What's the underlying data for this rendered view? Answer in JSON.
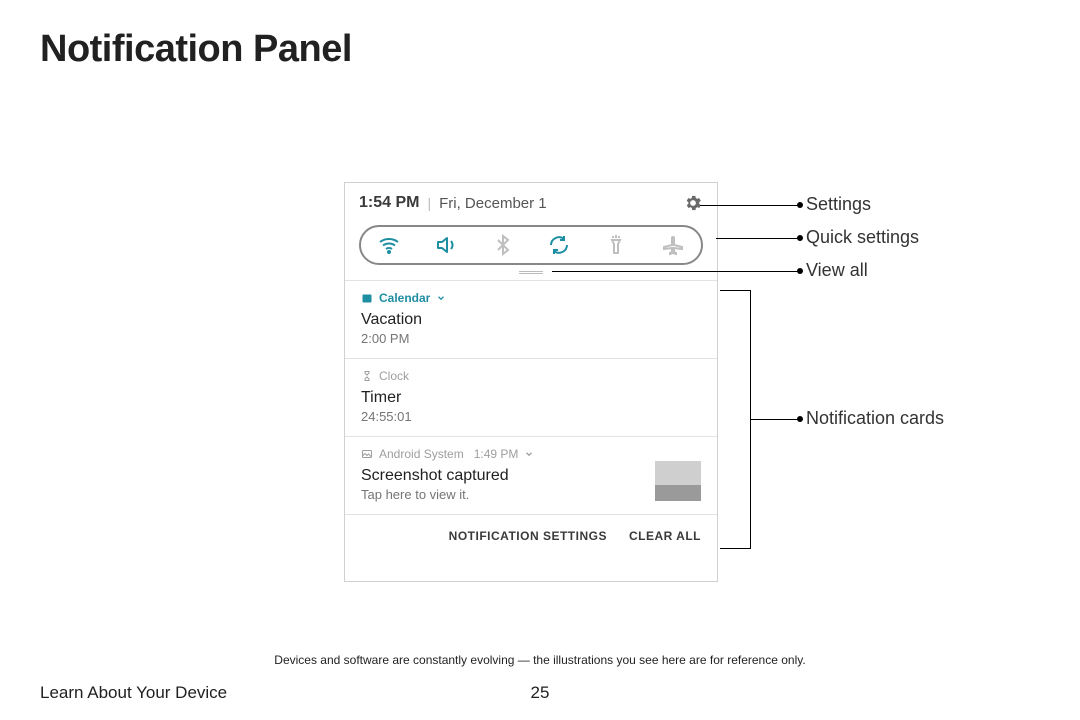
{
  "page": {
    "title": "Notification Panel",
    "disclaimer": "Devices and software are constantly evolving — the illustrations you see here are for reference only.",
    "section": "Learn About Your Device",
    "number": "25"
  },
  "callouts": {
    "settings": "Settings",
    "quick_settings": "Quick settings",
    "view_all": "View all",
    "notification_cards": "Notification cards"
  },
  "panel": {
    "time": "1:54 PM",
    "date": "Fri, December 1",
    "divider": "|",
    "footer": {
      "settings": "NOTIFICATION SETTINGS",
      "clear": "CLEAR ALL"
    }
  },
  "cards": [
    {
      "app": "Calendar",
      "title": "Vacation",
      "sub": "2:00 PM",
      "time": ""
    },
    {
      "app": "Clock",
      "title": "Timer",
      "sub": "24:55:01",
      "time": ""
    },
    {
      "app": "Android System",
      "title": "Screenshot captured",
      "sub": "Tap here to view it.",
      "time": "1:49 PM"
    }
  ]
}
